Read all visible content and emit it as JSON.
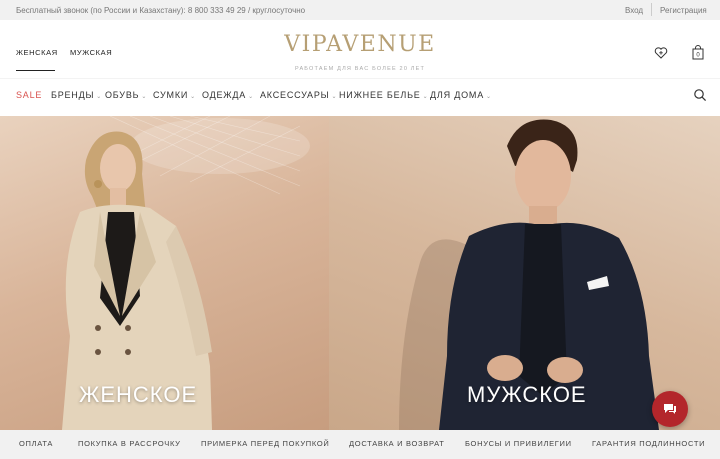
{
  "topbar": {
    "phone": "Бесплатный звонок (по России и Казахстану): 8 800 333 49 29 / круглосуточно",
    "login": "Вход",
    "register": "Регистрация"
  },
  "header": {
    "tabs": [
      "ЖЕНСКАЯ",
      "МУЖСКАЯ"
    ],
    "active_tab": "ЖЕНСКАЯ",
    "logo": "VIPAVENUE",
    "tagline": "РАБОТАЕМ ДЛЯ ВАС БОЛЕЕ 20 ЛЕТ",
    "icons": [
      "favorites-heart-icon",
      "shopping-bag-icon"
    ]
  },
  "nav": {
    "sale": "SALE",
    "items": [
      "БРЕНДЫ",
      "ОБУВЬ",
      "СУМКИ",
      "ОДЕЖДА",
      "АКСЕССУАРЫ",
      "НИЖНЕЕ БЕЛЬЕ",
      "ДЛЯ ДОМА"
    ],
    "search_icon": "search-icon",
    "sale_color": "#d9534f"
  },
  "hero": {
    "women_label": "ЖЕНСКОЕ",
    "men_label": "МУЖСКОЕ"
  },
  "chat": {
    "icon": "chat-bubbles-icon",
    "color": "#b3262b"
  },
  "footer": {
    "items": [
      "ОПЛАТА",
      "ПОКУПКА В РАССРОЧКУ",
      "ПРИМЕРКА ПЕРЕД ПОКУПКОЙ",
      "ДОСТАВКА И ВОЗВРАТ",
      "БОНУСЫ И ПРИВИЛЕГИИ",
      "ГАРАНТИЯ ПОДЛИННОСТИ"
    ]
  },
  "colors": {
    "logo": "#b69f74",
    "topbar_bg": "#f1f1f1"
  }
}
